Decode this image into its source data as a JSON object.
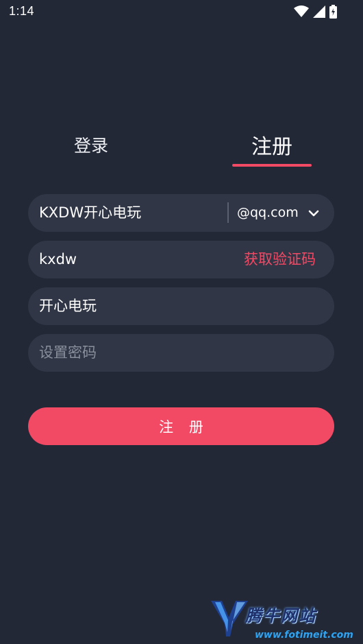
{
  "status_bar": {
    "time": "1:14",
    "icons": [
      "wifi-icon",
      "signal-icon",
      "battery-charging-icon"
    ]
  },
  "tabs": [
    {
      "label": "登录",
      "active": false
    },
    {
      "label": "注册",
      "active": true
    }
  ],
  "form": {
    "email_user": {
      "value": "KXDW开心电玩"
    },
    "email_domain": {
      "value": "@qq.com"
    },
    "code_field": {
      "value": "kxdw",
      "button_label": "获取验证码"
    },
    "nickname": {
      "value": "开心电玩"
    },
    "password": {
      "value": "",
      "placeholder": "设置密码"
    },
    "submit_label": "注 册"
  },
  "watermark": {
    "title": "腾牛网站",
    "url": "www.fotimeit.com"
  },
  "colors": {
    "background": "#232837",
    "field_background": "#303646",
    "accent": "#f24964",
    "placeholder": "#8a8f9c"
  }
}
